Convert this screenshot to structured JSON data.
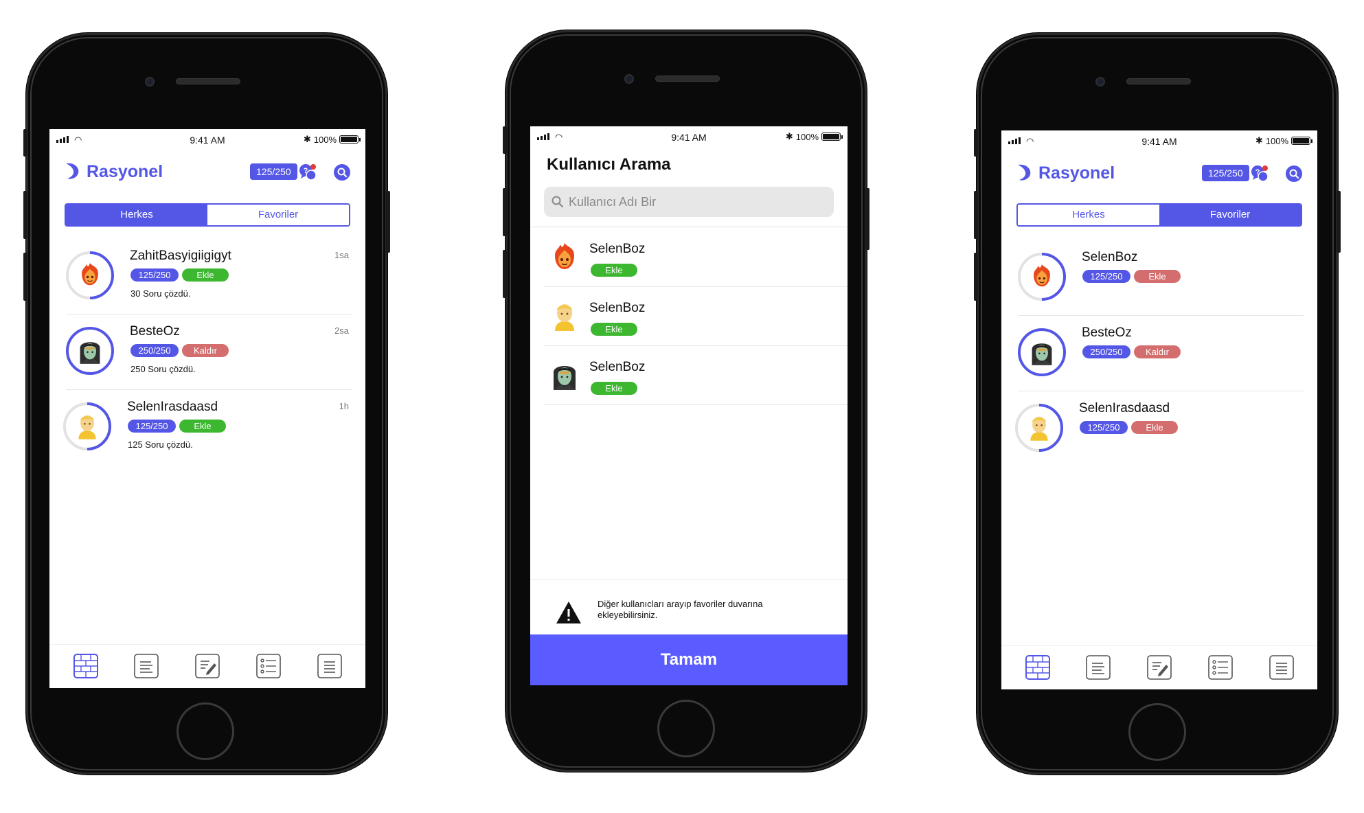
{
  "status_bar": {
    "time": "9:41 AM",
    "battery": "100%"
  },
  "app": {
    "name": "Rasyonel",
    "score": "125/250"
  },
  "tabs": {
    "everyone": "Herkes",
    "favorites": "Favoriler"
  },
  "feed": [
    {
      "name": "ZahitBasyigiigigyt",
      "time": "1sa",
      "score": "125/250",
      "action": "Ekle",
      "solved": "30 Soru çözdü."
    },
    {
      "name": "BesteOz",
      "time": "2sa",
      "score": "250/250",
      "action": "Kaldır",
      "solved": "250 Soru çözdü."
    },
    {
      "name": "SelenIrasdaasd",
      "time": "1h",
      "score": "125/250",
      "action": "Ekle",
      "solved": "125 Soru çözdü."
    }
  ],
  "search": {
    "title": "Kullanıcı Arama",
    "placeholder": "Kullanıcı Adı Bir",
    "results": [
      {
        "name": "SelenBoz",
        "action": "Ekle"
      },
      {
        "name": "SelenBoz",
        "action": "Ekle"
      },
      {
        "name": "SelenBoz",
        "action": "Ekle"
      }
    ],
    "notice": "Diğer kullanıcları arayıp favoriler duvarına ekleyebilirsiniz.",
    "done": "Tamam"
  },
  "favorites": [
    {
      "name": "SelenBoz",
      "score": "125/250",
      "action": "Ekle"
    },
    {
      "name": "BesteOz",
      "score": "250/250",
      "action": "Kaldır"
    },
    {
      "name": "SelenIrasdaasd",
      "score": "125/250",
      "action": "Ekle"
    }
  ],
  "colors": {
    "brand": "#5457e6",
    "add_green": "#3cb72f",
    "remove_red": "#d46d6d",
    "button_blue": "#5a5cff"
  },
  "icons": [
    "logo-icon",
    "chat-icon",
    "search-icon",
    "wall-icon",
    "list-icon",
    "edit-icon",
    "checklist-icon",
    "menu-icon",
    "warning-icon",
    "fire-avatar-icon",
    "blonde-avatar-icon",
    "hooded-avatar-icon"
  ]
}
